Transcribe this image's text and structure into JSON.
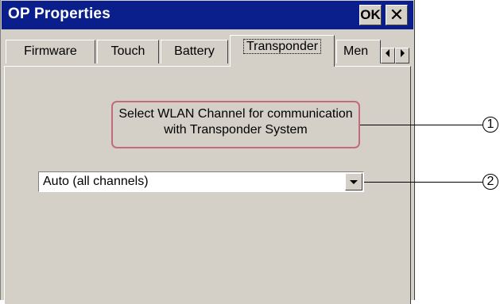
{
  "window": {
    "title": "OP Properties",
    "ok_label": "OK",
    "close_label": "✕"
  },
  "tabs": [
    {
      "label": "Firmware"
    },
    {
      "label": "Touch"
    },
    {
      "label": "Battery"
    },
    {
      "label": "Transponder",
      "active": true
    },
    {
      "label": "Men"
    }
  ],
  "tab_scroll": {
    "left_icon": "triangle-left",
    "right_icon": "triangle-right"
  },
  "content": {
    "description": "Select WLAN Channel for communication with Transponder System",
    "channel_select": {
      "value": "Auto (all channels)",
      "icon": "dropdown-arrow"
    }
  },
  "callouts": [
    {
      "number": "1"
    },
    {
      "number": "2"
    }
  ],
  "colors": {
    "titlebar": "#0a1e8c",
    "face": "#d4d0c8",
    "highlight_box": "#c46a78"
  }
}
